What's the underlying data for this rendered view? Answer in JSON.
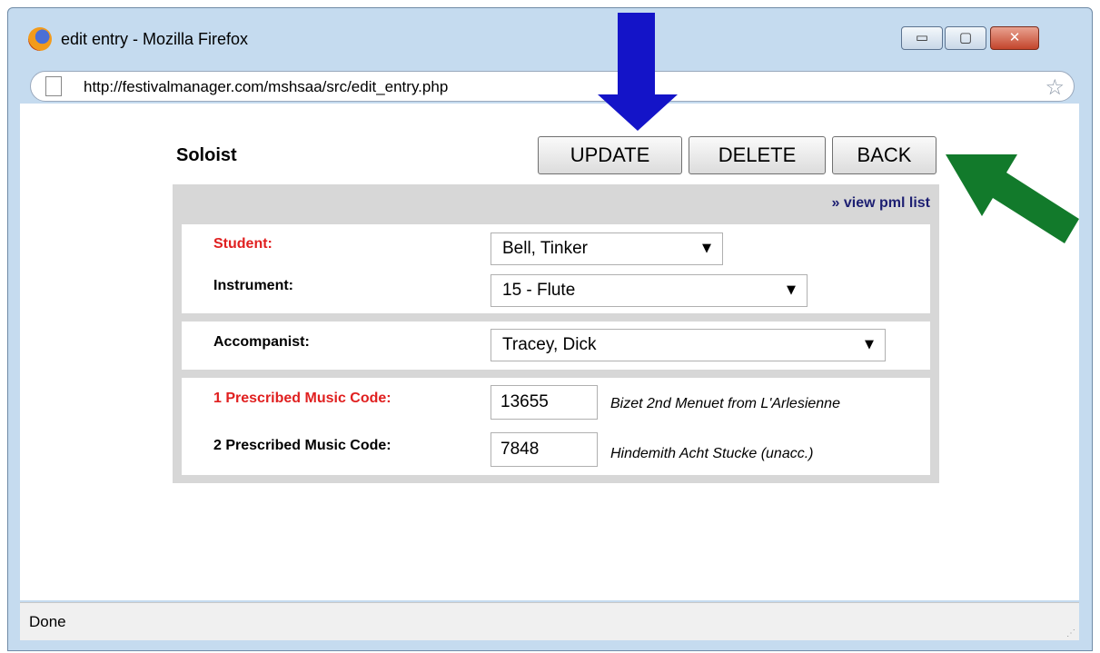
{
  "window": {
    "title": "edit entry - Mozilla Firefox",
    "controls": {
      "minimize": "▭",
      "maximize": "▢",
      "close": "✕"
    }
  },
  "address_bar": {
    "url": "http://festivalmanager.com/mshsaa/src/edit_entry.php"
  },
  "page": {
    "heading": "Soloist",
    "buttons": {
      "update": "UPDATE",
      "delete": "DELETE",
      "back": "BACK"
    },
    "view_link": "» view pml list",
    "student": {
      "label": "Student:",
      "value": "Bell, Tinker"
    },
    "instrument": {
      "label": "Instrument:",
      "value": "15 - Flute"
    },
    "accompanist": {
      "label": "Accompanist:",
      "value": "Tracey, Dick"
    },
    "music": [
      {
        "label": "1 Prescribed Music Code:",
        "code": "13655",
        "title": "Bizet 2nd Menuet from L'Arlesienne"
      },
      {
        "label": "2 Prescribed Music Code:",
        "code": "7848",
        "title": "Hindemith Acht Stucke (unacc.)"
      }
    ]
  },
  "status_bar": {
    "text": "Done"
  },
  "annotations": {
    "blue_arrow_color": "#1414c8",
    "green_arrow_color": "#127a2b"
  },
  "icons": [
    "firefox-icon",
    "page-icon",
    "bookmark-star-icon",
    "dropdown-arrow-icon",
    "resize-grip-icon"
  ]
}
